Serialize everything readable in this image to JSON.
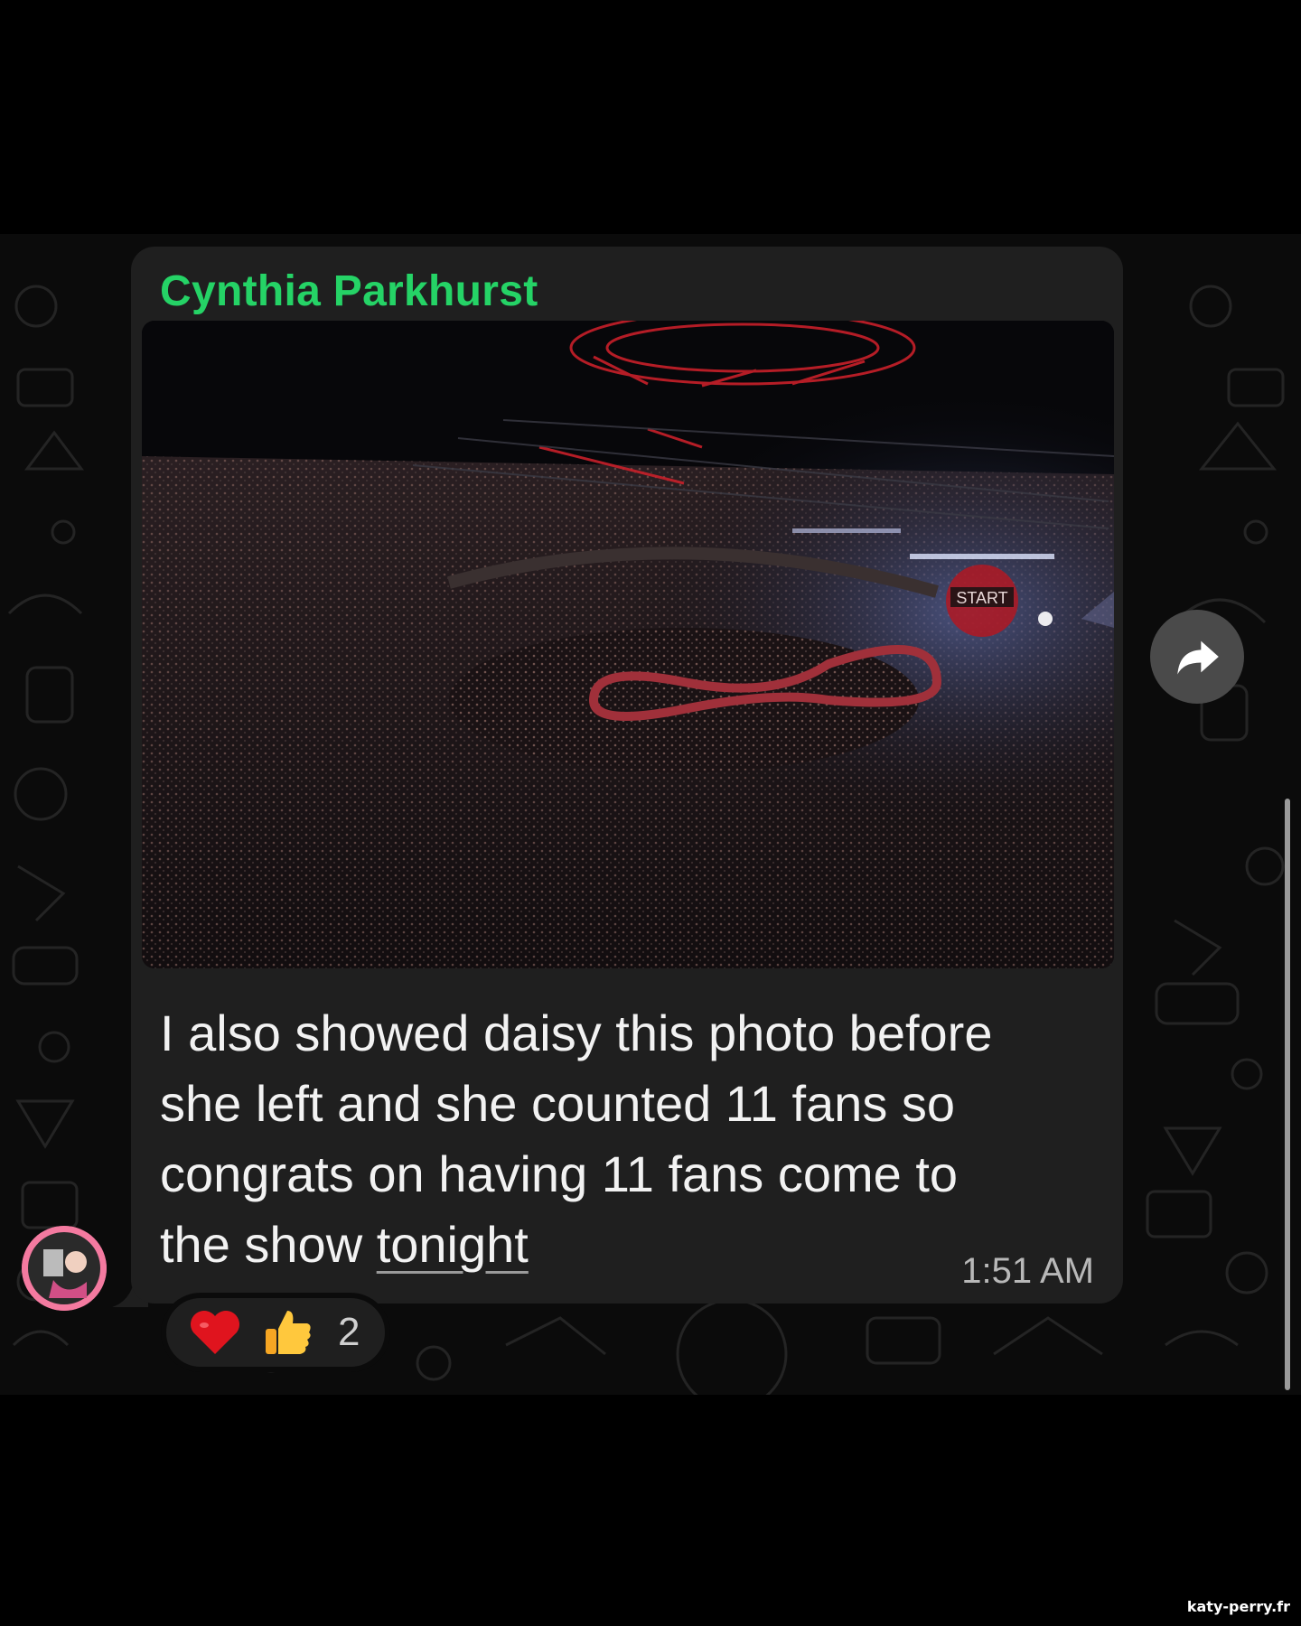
{
  "message": {
    "sender": "Cynthia Parkhurst",
    "text_before": "I also showed daisy this photo before she left and she counted 11 fans so congrats on having 11 fans come to the show ",
    "text_link": "tonight",
    "timestamp": "1:51 AM",
    "photo_stage_text": "START"
  },
  "reactions": {
    "items": [
      "heart-emoji",
      "thumbs-up-emoji"
    ],
    "count": "2"
  },
  "icons": {
    "forward": "forward-arrow-icon",
    "avatar": "avatar"
  },
  "colors": {
    "sender_name": "#25d366",
    "bubble": "#1f1f1f",
    "background": "#000000"
  },
  "watermark": "katy-perry.fr"
}
